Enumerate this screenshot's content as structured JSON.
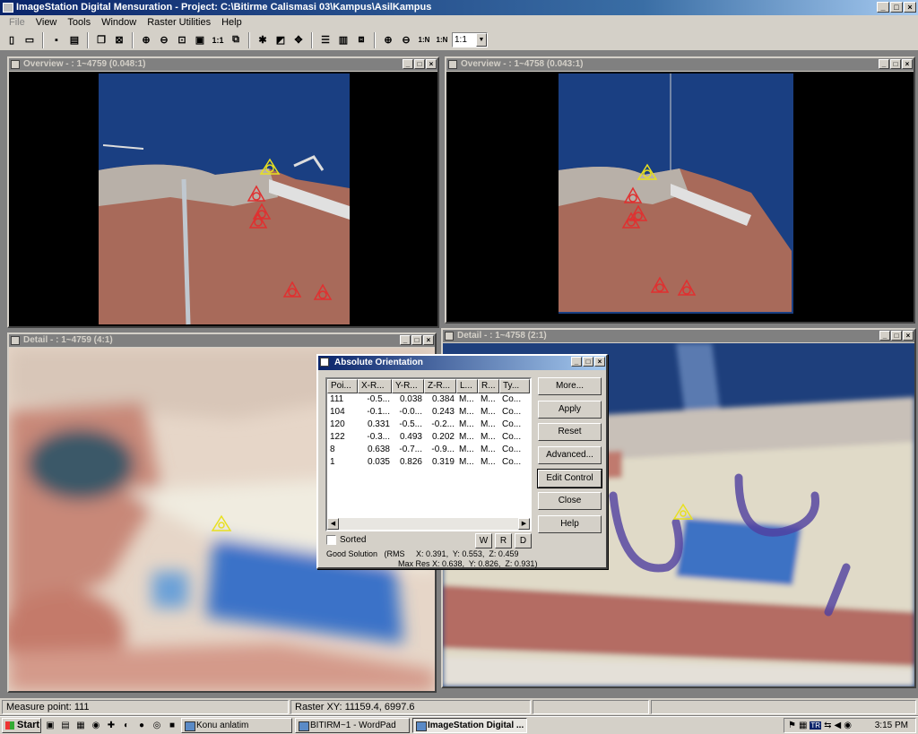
{
  "app": {
    "title": "ImageStation Digital Mensuration - Project: C:\\Bitirme Calismasi 03\\Kampus\\AsilKampus"
  },
  "menu": [
    "File",
    "View",
    "Tools",
    "Window",
    "Raster Utilities",
    "Help"
  ],
  "toolbar": {
    "zoom_value": "1:1",
    "one_to_one": "1:1",
    "one_to_n": "1:N"
  },
  "windows": {
    "overview_left": {
      "title": "Overview - : 1~4759  (0.048:1)"
    },
    "overview_right": {
      "title": "Overview - : 1~4758  (0.043:1)"
    },
    "detail_left": {
      "title": "Detail - : 1~4759  (4:1)"
    },
    "detail_right": {
      "title": "Detail - : 1~4758  (2:1)"
    }
  },
  "dialog": {
    "title": "Absolute Orientation",
    "columns": [
      "Poi...",
      "X-R...",
      "Y-R...",
      "Z-R...",
      "L...",
      "R...",
      "Ty..."
    ],
    "rows": [
      [
        "111",
        "-0.5...",
        "0.038",
        "0.384",
        "M...",
        "M...",
        "Co..."
      ],
      [
        "104",
        "-0.1...",
        "-0.0...",
        "0.243",
        "M...",
        "M...",
        "Co..."
      ],
      [
        "120",
        "0.331",
        "-0.5...",
        "-0.2...",
        "M...",
        "M...",
        "Co..."
      ],
      [
        "122",
        "-0.3...",
        "0.493",
        "0.202",
        "M...",
        "M...",
        "Co..."
      ],
      [
        "8",
        "0.638",
        "-0.7...",
        "-0.9...",
        "M...",
        "M...",
        "Co..."
      ],
      [
        "1",
        "0.035",
        "0.826",
        "0.319",
        "M...",
        "M...",
        "Co..."
      ]
    ],
    "buttons": {
      "more": "More...",
      "apply": "Apply",
      "reset": "Reset",
      "advanced": "Advanced...",
      "edit_control": "Edit Control",
      "close": "Close",
      "help": "Help"
    },
    "sorted_label": "Sorted",
    "w": "W",
    "r": "R",
    "d": "D",
    "solution_line1": "Good Solution   (RMS     X: 0.391,  Y: 0.553,  Z: 0.459",
    "solution_line2": "                                Max Res X: 0.638,  Y: 0.826,  Z: 0.931)"
  },
  "status": {
    "measure": "Measure point: 111",
    "raster": "Raster XY: 11159.4, 6997.6"
  },
  "taskbar": {
    "start": "Start",
    "tasks": [
      "Konu anlatim",
      "BITIRM~1 - WordPad",
      "ImageStation Digital ..."
    ],
    "tray_lang": "TR",
    "clock": "3:15 PM"
  },
  "colors": {
    "title_active": "#0a246a",
    "marker_red": "#e03030",
    "marker_yellow": "#e8e020"
  }
}
